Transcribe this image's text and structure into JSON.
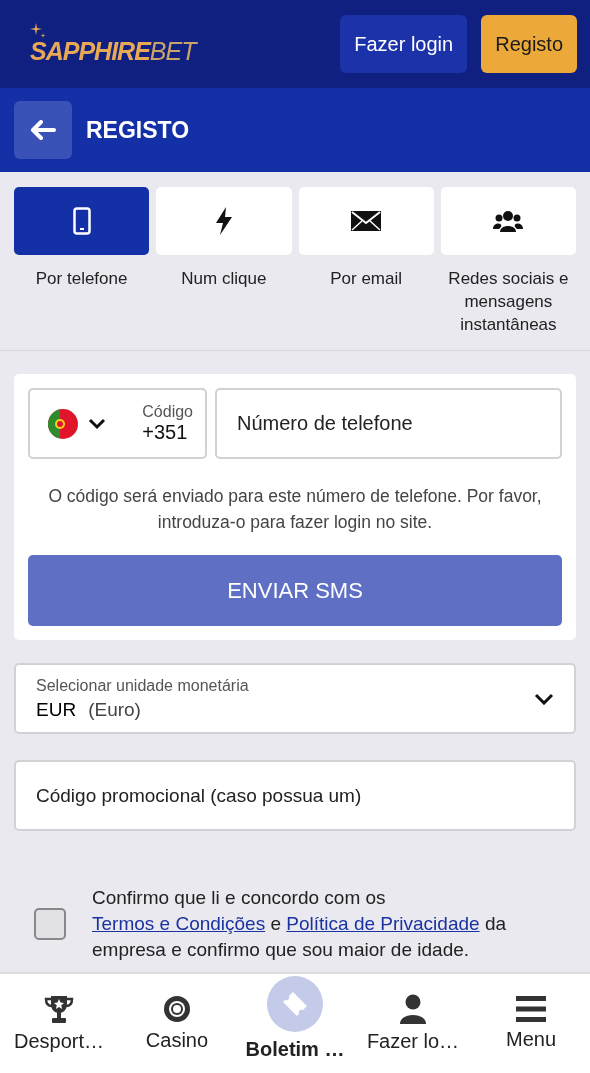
{
  "header": {
    "logo": {
      "primary": "SAPPHIRE",
      "secondary": "BET"
    },
    "login_button": "Fazer login",
    "register_button": "Registo"
  },
  "page_title": "REGISTO",
  "methods": [
    {
      "kind": "phone",
      "label": "Por telefone",
      "selected": true
    },
    {
      "kind": "bolt",
      "label": "Num clique",
      "selected": false
    },
    {
      "kind": "mail",
      "label": "Por email",
      "selected": false
    },
    {
      "kind": "users",
      "label": "Redes sociais e mensagens instantâneas",
      "selected": false
    }
  ],
  "phone_form": {
    "code_label": "Código",
    "code_value": "+351",
    "phone_placeholder": "Número de telefone",
    "hint": "O código será enviado para este número de telefone. Por favor, introduza-o para fazer login no site.",
    "submit_button": "ENVIAR SMS"
  },
  "currency": {
    "label": "Selecionar unidade monetária",
    "code": "EUR",
    "name": "(Euro)"
  },
  "promo": {
    "placeholder": "Código promocional (caso possua um)"
  },
  "consent": {
    "checked": false,
    "parts": [
      {
        "text": "Confirmo que li e concordo com os ",
        "link": false
      },
      {
        "text": "Termos e Condições",
        "link": true
      },
      {
        "text": " e ",
        "link": false
      },
      {
        "text": "Política de Privacidade",
        "link": true
      },
      {
        "text": " da empresa e confirmo que sou maior de idade.",
        "link": false
      }
    ]
  },
  "bottom_nav": [
    {
      "kind": "trophy",
      "label": "Desport…",
      "selected": false
    },
    {
      "kind": "chip",
      "label": "Casino",
      "selected": false
    },
    {
      "kind": "ticket",
      "label": "Boletim …",
      "selected": true
    },
    {
      "kind": "user",
      "label": "Fazer lo…",
      "selected": false
    },
    {
      "kind": "menu",
      "label": "Menu",
      "selected": false
    }
  ]
}
